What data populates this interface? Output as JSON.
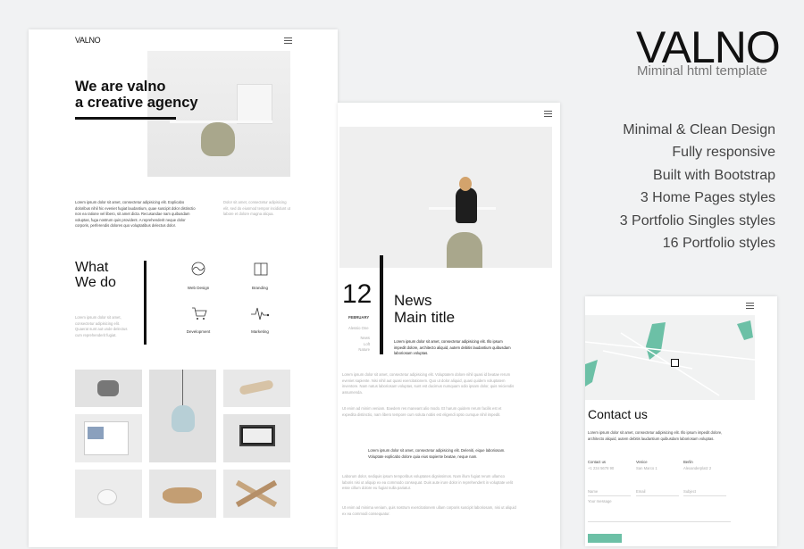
{
  "brand": {
    "logo": "VALNO",
    "subtitle": "Miminal html template"
  },
  "features": [
    "Minimal & Clean Design",
    "Fully responsive",
    "Built with Bootstrap",
    "3 Home Pages styles",
    "3 Portfolio Singles styles",
    "16 Portfolio styles"
  ],
  "home": {
    "logo": "VALNO",
    "hero_line1": "We are valno",
    "hero_line2": "a creative agency",
    "intro": "Lorem ipsum dolor sit amet, consectetur adipisicing elit. Explicabo doloribus nihil hic eveniet fugiat laudantium, quae suscipit dolor distinctio non ea ratione vel libero, sit amet dicta. Recusandae nam quibusdam voluptas, fuga nostrum quis provident. A reprehenderit neque dolor corporis, perferendis dolores quo voluptatibus delectus dolor.",
    "intro_side": "Dolor sit amet, consectetur adipisicing elit, sed do eiusmod tempor incididunt ut labore et dolore magna aliqua.",
    "what_title_1": "What",
    "what_title_2": "We do",
    "what_text": "Lorem ipsum dolor sit amet, consectetur adipisicing elit. Quaerat sunt aut unde delectus cum reprehenderit fugiat.",
    "services": [
      {
        "label": "Web Design",
        "icon": "wave-circle-icon"
      },
      {
        "label": "Branding",
        "icon": "book-icon"
      },
      {
        "label": "Development",
        "icon": "cart-icon"
      },
      {
        "label": "Marketing",
        "icon": "pulse-icon"
      }
    ]
  },
  "news": {
    "day": "12",
    "month": "FEBRUARY",
    "author": "Alessio One",
    "tags": "News\nLoft\nNature",
    "title_1": "News",
    "title_2": "Main title",
    "lead": "Lorem ipsum dolor sit amet, consectetur adipisicing elit. Illo ipsum impedit dolore, architecto aliquid, autem debitis laudantium quibusdam laboriosam voluptas.",
    "body_1": "Lorem ipsum dolor sit amet, consectetur adipisicing elit. Voluptatem dolore nihil quasi id beatae rerum eveniet sapiente. Nisi nihil aut quasi exercitationem. Quo ut dolor aliquid, quasi quidem voluptatem inventore. Nam natus laboriosam voluptas, sunt est ducimus numquam odio ipsam dolor, quis reiciendis assumenda.",
    "body_2": "Ut enim ad minim veniam. Eaedem res maneant alio modo. Et harum quidem rerum facilis est et expedita distinctio, nam libero tempore cum soluta nobis est eligendi optio cumque nihil impedit.",
    "quote": "Lorem ipsum dolor sit amet, consectetur adipisicing elit. Deleniti, eique laboriosam. Voluptate explicabo dolore quia eius sapiente beatae, neque nam.",
    "body_3": "Laborum dolor, sediquis ipsum temporibus voluptates dignissimos. Nam illum fugiat rerum ullamco laboris nisi ut aliquip ex ea commodo consequat. Duis aute irure dolor in reprehenderit in voluptate velit esse cillum dolore eu fugiat nulla pariatur.",
    "body_4": "Ut enim ad minima veniam, quis nostrum exercitationem ullam corporis suscipit laboriosam, nisi ut aliquid ex ea commodi consequatur."
  },
  "contact": {
    "title": "Contact us",
    "text": "Lorem ipsum dolor sit amet, consectetur adipisicing elit. Illo ipsum impedit dolore, architecto aliquid, autem debitis laudantium quibusdam laboriosam voluptas.",
    "cols": [
      {
        "head": "Contact us",
        "line": "+1 234 5678 90"
      },
      {
        "head": "Venice",
        "line": "San Marco 1"
      },
      {
        "head": "Berlin",
        "line": "Alexanderplatz 2"
      }
    ],
    "fields": [
      "Name",
      "Email",
      "Subject"
    ],
    "message": "Your message",
    "map_color": "#6cc0a6"
  }
}
